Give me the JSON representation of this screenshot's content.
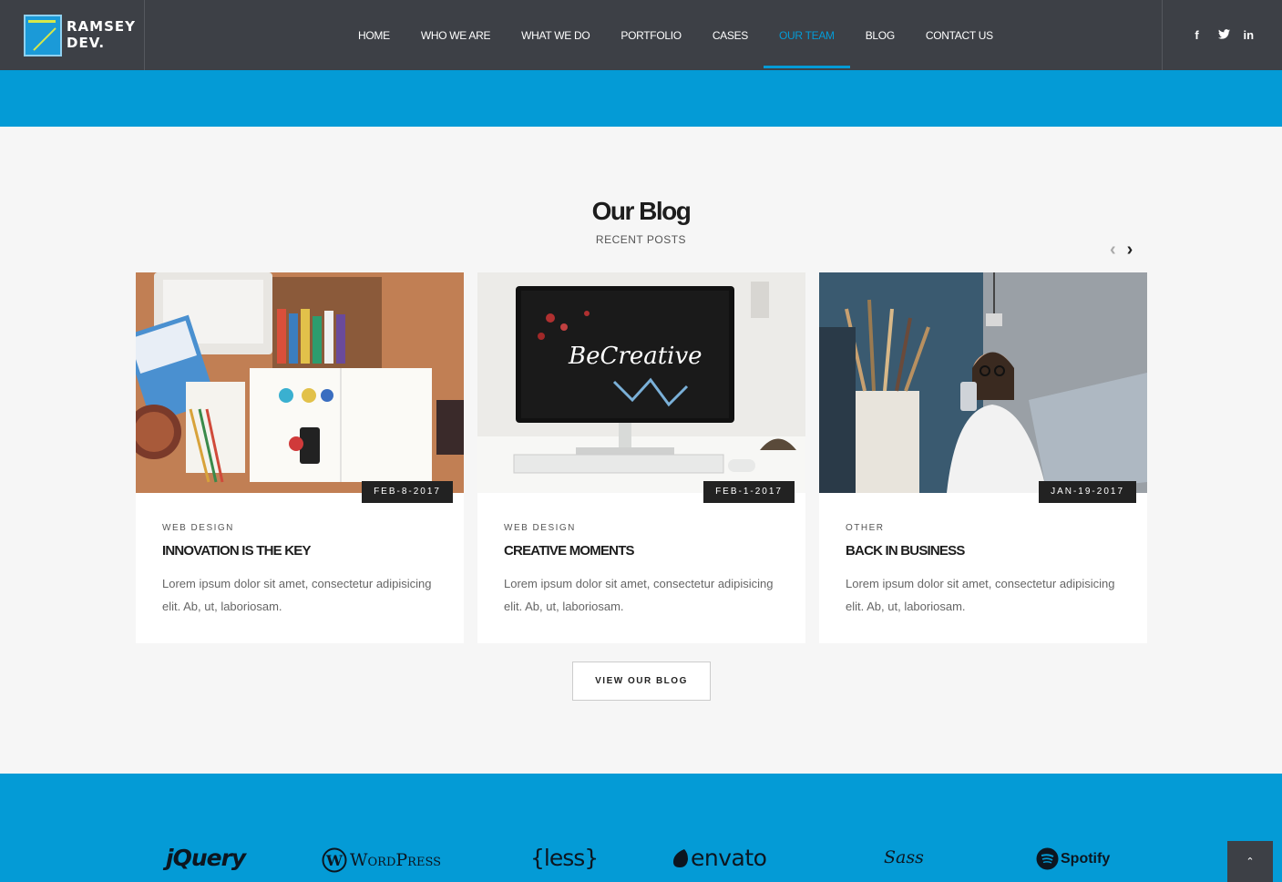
{
  "brand": {
    "logo_line1": "RAMSEY",
    "logo_line2": "DEV."
  },
  "nav": [
    {
      "label": "HOME"
    },
    {
      "label": "WHO WE ARE"
    },
    {
      "label": "WHAT WE DO"
    },
    {
      "label": "PORTFOLIO"
    },
    {
      "label": "CASES"
    },
    {
      "label": "OUR TEAM",
      "active": true
    },
    {
      "label": "BLOG"
    },
    {
      "label": "CONTACT US"
    }
  ],
  "social": {
    "facebook": "f",
    "twitter": "t",
    "linkedin": "in"
  },
  "blog": {
    "title": "Our Blog",
    "subtitle": "RECENT POSTS",
    "prev_arrow": "‹",
    "next_arrow": "›",
    "posts": [
      {
        "date": "FEB-8-2017",
        "category": "WEB DESIGN",
        "title": "INNOVATION IS THE KEY",
        "excerpt": "Lorem ipsum dolor sit amet, consectetur adipisicing elit. Ab, ut, laboriosam."
      },
      {
        "date": "FEB-1-2017",
        "category": "WEB DESIGN",
        "title": "CREATIVE MOMENTS",
        "excerpt": "Lorem ipsum dolor sit amet, consectetur adipisicing elit. Ab, ut, laboriosam."
      },
      {
        "date": "JAN-19-2017",
        "category": "OTHER",
        "title": "BACK IN BUSINESS",
        "excerpt": "Lorem ipsum dolor sit amet, consectetur adipisicing elit. Ab, ut, laboriosam."
      }
    ],
    "button": "VIEW OUR BLOG"
  },
  "clients": [
    "jQuery",
    "WordPress",
    "{less}",
    "envato",
    "Sass",
    "Spotify"
  ],
  "colors": {
    "accent": "#049bd6",
    "header": "#3d4046",
    "dark": "#222222"
  },
  "back_to_top": "⌃"
}
